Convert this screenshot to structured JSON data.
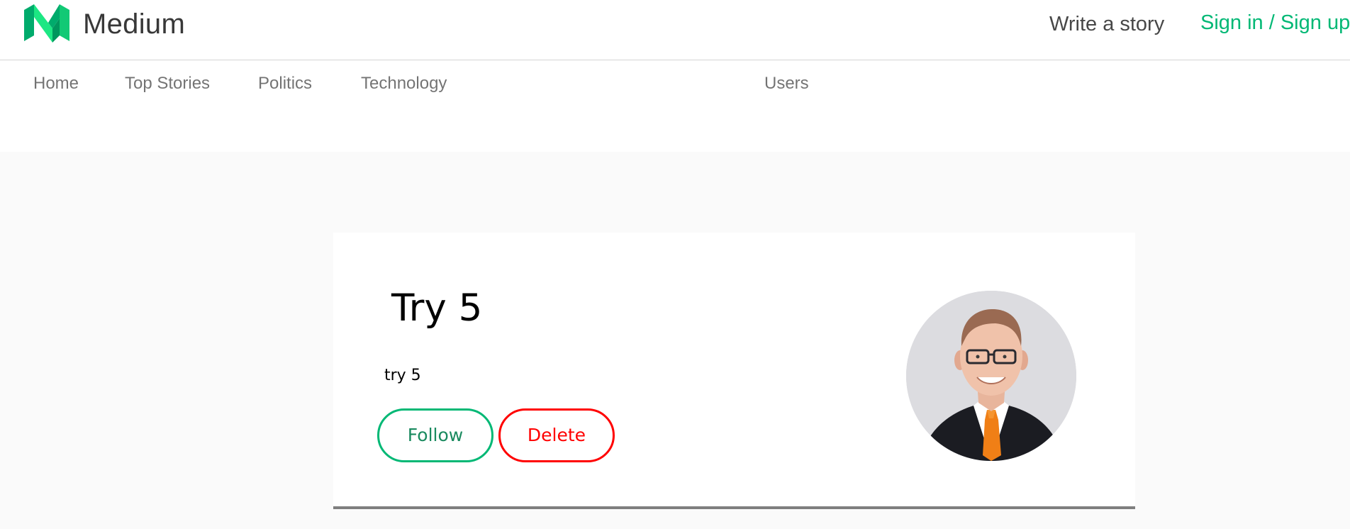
{
  "header": {
    "brand": "Medium",
    "write_story": "Write a story",
    "sign_in": "Sign in / Sign up"
  },
  "nav": {
    "items": [
      "Home",
      "Top Stories",
      "Politics",
      "Technology",
      "Users"
    ]
  },
  "story": {
    "title": "Try 5",
    "text": "try 5",
    "follow_label": "Follow",
    "delete_label": "Delete"
  },
  "colors": {
    "accent": "#02b875",
    "danger": "#ff0000",
    "page_background": "#fafafa"
  },
  "icons": {
    "logo": "medium-logo-icon"
  }
}
